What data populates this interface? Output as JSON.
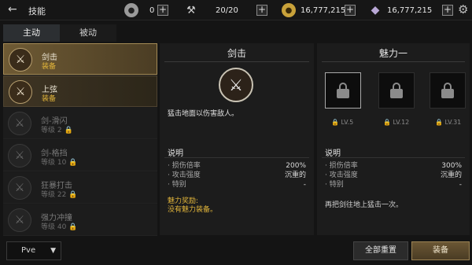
{
  "topbar": {
    "title": "技能",
    "resources": [
      {
        "icon": "silver-coin-icon",
        "value": "0"
      },
      {
        "icon": "stamina-hammer-icon",
        "value": "20/20"
      },
      {
        "icon": "gold-coin-icon",
        "value": "16,777,215"
      },
      {
        "icon": "crystal-gem-icon",
        "value": "16,777,215"
      }
    ]
  },
  "tabs": [
    {
      "label": "主动",
      "active": true
    },
    {
      "label": "被动",
      "active": false
    }
  ],
  "skills": [
    {
      "name": "剑击",
      "sub": "装备",
      "state": "selected"
    },
    {
      "name": "上弦",
      "sub": "装备",
      "state": "learned"
    },
    {
      "name": "剑-滑闪",
      "sub": "等级 2",
      "state": "locked"
    },
    {
      "name": "剑-格挡",
      "sub": "等级 10",
      "state": "locked"
    },
    {
      "name": "狂暴打击",
      "sub": "等级 22",
      "state": "locked"
    },
    {
      "name": "强力冲撞",
      "sub": "等级 40",
      "state": "locked"
    }
  ],
  "mode_select": {
    "value": "Pve"
  },
  "detail": {
    "title": "剑击",
    "description": "猛击地面以伤害敌人。",
    "section_label": "说明",
    "stats": [
      {
        "key": "· 损伤倍率",
        "value": "200%"
      },
      {
        "key": "· 攻击强度",
        "value": "沉重的"
      },
      {
        "key": "· 特别",
        "value": "-"
      }
    ],
    "charm_line1": "魅力奖励:",
    "charm_line2": "没有魅力装备。"
  },
  "charm": {
    "title": "魅力一",
    "slots": [
      {
        "level": "LV.5"
      },
      {
        "level": "LV.12"
      },
      {
        "level": "LV.31"
      }
    ],
    "section_label": "说明",
    "stats": [
      {
        "key": "· 损伤倍率",
        "value": "300%"
      },
      {
        "key": "· 攻击强度",
        "value": "沉重的"
      },
      {
        "key": "· 特别",
        "value": "-"
      }
    ],
    "description": "再把剑往地上猛击一次。"
  },
  "buttons": {
    "reset": "全部重置",
    "equip": "装备"
  }
}
